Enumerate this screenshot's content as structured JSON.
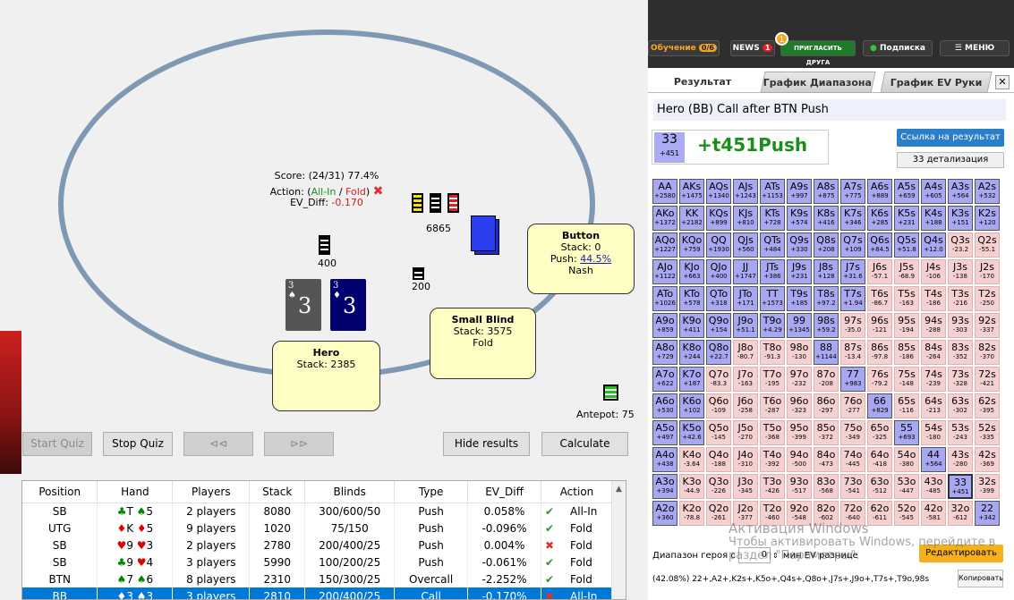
{
  "table_area": {
    "score": "Score: (24/31) 77.4%",
    "action_prefix": "Action: (",
    "action_allin": "All-In",
    "action_sep": " / ",
    "action_fold": "Fold",
    "action_suffix": ")",
    "evdiff_label": "EV_Diff: ",
    "evdiff_value": "-0.170",
    "pot_chips": "6865",
    "hero_chips": "400",
    "sb_chips": "200",
    "antepot": "Antepot: 75",
    "hero_cards": [
      {
        "rank": "3",
        "suit": "♠"
      },
      {
        "rank": "3",
        "suit": "♦"
      }
    ],
    "seats": {
      "hero": {
        "name": "Hero",
        "stack": "Stack: 2385"
      },
      "sb": {
        "name": "Small Blind",
        "stack": "Stack: 3575",
        "action": "Fold"
      },
      "button": {
        "name": "Button",
        "stack": "Stack: 0",
        "push_label": "Push: ",
        "push_value": "44.5%",
        "note": "Nash"
      }
    }
  },
  "controls": {
    "start_quiz": "Start Quiz",
    "stop_quiz": "Stop Quiz",
    "prev": "⊲⊲",
    "next": "⊳⊳",
    "hide_results": "Hide results",
    "calculate": "Calculate"
  },
  "history": {
    "headers": [
      "Position",
      "Hand",
      "Players",
      "Stack",
      "Blinds",
      "Type",
      "EV_Diff",
      "Action"
    ],
    "rows": [
      {
        "pos": "SB",
        "c1": {
          "rank": "T",
          "suit": "club"
        },
        "c2": {
          "rank": "5",
          "suit": "spade"
        },
        "players": "2 players",
        "stack": "8080",
        "blinds": "300/600/50",
        "type": "Push",
        "ev": "0.058%",
        "ok": true,
        "action": "All-In"
      },
      {
        "pos": "UTG",
        "c1": {
          "rank": "K",
          "suit": "diam"
        },
        "c2": {
          "rank": "5",
          "suit": "diam"
        },
        "players": "9 players",
        "stack": "1020",
        "blinds": "75/150",
        "type": "Push",
        "ev": "-0.096%",
        "ok": true,
        "action": "Fold"
      },
      {
        "pos": "SB",
        "c1": {
          "rank": "9",
          "suit": "heart"
        },
        "c2": {
          "rank": "3",
          "suit": "heart"
        },
        "players": "2 players",
        "stack": "2780",
        "blinds": "200/400/25",
        "type": "Push",
        "ev": "0.004%",
        "ok": false,
        "action": "Fold"
      },
      {
        "pos": "SB",
        "c1": {
          "rank": "9",
          "suit": "club"
        },
        "c2": {
          "rank": "4",
          "suit": "heart"
        },
        "players": "3 players",
        "stack": "5990",
        "blinds": "100/200/25",
        "type": "Push",
        "ev": "-0.061%",
        "ok": true,
        "action": "Fold"
      },
      {
        "pos": "BTN",
        "c1": {
          "rank": "7",
          "suit": "spade"
        },
        "c2": {
          "rank": "6",
          "suit": "spade"
        },
        "players": "8 players",
        "stack": "2310",
        "blinds": "150/300/25",
        "type": "Overcall",
        "ev": "-2.252%",
        "ok": true,
        "action": "Fold"
      },
      {
        "pos": "BB",
        "c1": {
          "rank": "3",
          "suit": "diam"
        },
        "c2": {
          "rank": "3",
          "suit": "spade"
        },
        "players": "3 players",
        "stack": "2810",
        "blinds": "200/400/25",
        "type": "Call",
        "ev": "-0.170%",
        "ok": false,
        "action": "All-In",
        "selected": true
      }
    ]
  },
  "topbar": {
    "training": "Обучение",
    "training_badge": "0/6",
    "news": "NEWS",
    "news_badge": "1",
    "invite": "ПРИГЛАСИТЬ ДРУГА",
    "invite_badge": "1",
    "subscription": "Подписка",
    "menu": "МЕНЮ"
  },
  "tabs": [
    "Результат",
    "График Диапазона",
    "График EV Руки"
  ],
  "result": {
    "header": "Hero (BB) Call after BTN Push",
    "hand": "33",
    "hand_ev": "+451",
    "ev_text": "+t451Push",
    "link_button": "Ссылка на результат",
    "detail_button": "33 детализация"
  },
  "range_grid": [
    [
      [
        "AA",
        "+2580",
        "c"
      ],
      [
        "AKs",
        "+1475",
        "c"
      ],
      [
        "AQs",
        "+1340",
        "c"
      ],
      [
        "AJs",
        "+1243",
        "c"
      ],
      [
        "ATs",
        "+1153",
        "c"
      ],
      [
        "A9s",
        "+997",
        "c"
      ],
      [
        "A8s",
        "+875",
        "c"
      ],
      [
        "A7s",
        "+775",
        "c"
      ],
      [
        "A6s",
        "+889",
        "c"
      ],
      [
        "A5s",
        "+659",
        "c"
      ],
      [
        "A4s",
        "+605",
        "c"
      ],
      [
        "A3s",
        "+564",
        "c"
      ],
      [
        "A2s",
        "+532",
        "c"
      ]
    ],
    [
      [
        "AKo",
        "+1372",
        "c"
      ],
      [
        "KK",
        "+2182",
        "c"
      ],
      [
        "KQs",
        "+899",
        "c"
      ],
      [
        "KJs",
        "+810",
        "c"
      ],
      [
        "KTs",
        "+728",
        "c"
      ],
      [
        "K9s",
        "+574",
        "c"
      ],
      [
        "K8s",
        "+416",
        "c"
      ],
      [
        "K7s",
        "+346",
        "c"
      ],
      [
        "K6s",
        "+285",
        "c"
      ],
      [
        "K5s",
        "+231",
        "c"
      ],
      [
        "K4s",
        "+188",
        "c"
      ],
      [
        "K3s",
        "+151",
        "c"
      ],
      [
        "K2s",
        "+120",
        "c"
      ]
    ],
    [
      [
        "AQo",
        "+1227",
        "c"
      ],
      [
        "KQo",
        "+759",
        "c"
      ],
      [
        "QQ",
        "+1930",
        "c"
      ],
      [
        "QJs",
        "+560",
        "c"
      ],
      [
        "QTs",
        "+484",
        "c"
      ],
      [
        "Q9s",
        "+330",
        "c"
      ],
      [
        "Q8s",
        "+208",
        "c"
      ],
      [
        "Q7s",
        "+109",
        "c"
      ],
      [
        "Q6s",
        "+84.5",
        "c"
      ],
      [
        "Q5s",
        "+51.8",
        "c"
      ],
      [
        "Q4s",
        "+12.0",
        "c"
      ],
      [
        "Q3s",
        "-23.2",
        "f"
      ],
      [
        "Q2s",
        "-55.1",
        "f"
      ]
    ],
    [
      [
        "AJo",
        "+1122",
        "c"
      ],
      [
        "KJo",
        "+663",
        "c"
      ],
      [
        "QJo",
        "+400",
        "c"
      ],
      [
        "JJ",
        "+1747",
        "c"
      ],
      [
        "JTs",
        "+386",
        "c"
      ],
      [
        "J9s",
        "+231",
        "c"
      ],
      [
        "J8s",
        "+128",
        "c"
      ],
      [
        "J7s",
        "+31.6",
        "c"
      ],
      [
        "J6s",
        "-57.1",
        "f"
      ],
      [
        "J5s",
        "-68.9",
        "f"
      ],
      [
        "J4s",
        "-106",
        "f"
      ],
      [
        "J3s",
        "-138",
        "f"
      ],
      [
        "J2s",
        "-170",
        "f"
      ]
    ],
    [
      [
        "ATo",
        "+1026",
        "c"
      ],
      [
        "KTo",
        "+578",
        "c"
      ],
      [
        "QTo",
        "+318",
        "c"
      ],
      [
        "JTo",
        "+171",
        "c"
      ],
      [
        "TT",
        "+1573",
        "c"
      ],
      [
        "T9s",
        "+185",
        "c"
      ],
      [
        "T8s",
        "+97.2",
        "c"
      ],
      [
        "T7s",
        "+1.94",
        "c"
      ],
      [
        "T6s",
        "-86.7",
        "f"
      ],
      [
        "T5s",
        "-163",
        "f"
      ],
      [
        "T4s",
        "-186",
        "f"
      ],
      [
        "T3s",
        "-216",
        "f"
      ],
      [
        "T2s",
        "-250",
        "f"
      ]
    ],
    [
      [
        "A9o",
        "+859",
        "c"
      ],
      [
        "K9o",
        "+411",
        "c"
      ],
      [
        "Q9o",
        "+154",
        "c"
      ],
      [
        "J9o",
        "+51.1",
        "c"
      ],
      [
        "T9o",
        "+4.29",
        "c"
      ],
      [
        "99",
        "+1345",
        "c"
      ],
      [
        "98s",
        "+59.2",
        "c"
      ],
      [
        "97s",
        "-35.0",
        "f"
      ],
      [
        "96s",
        "-121",
        "f"
      ],
      [
        "95s",
        "-194",
        "f"
      ],
      [
        "94s",
        "-288",
        "f"
      ],
      [
        "93s",
        "-303",
        "f"
      ],
      [
        "92s",
        "-337",
        "f"
      ]
    ],
    [
      [
        "A8o",
        "+729",
        "c"
      ],
      [
        "K8o",
        "+244",
        "c"
      ],
      [
        "Q8o",
        "+22.7",
        "c"
      ],
      [
        "J8o",
        "-80.7",
        "f"
      ],
      [
        "T8o",
        "-91.3",
        "f"
      ],
      [
        "98o",
        "-130",
        "f"
      ],
      [
        "88",
        "+1144",
        "c"
      ],
      [
        "87s",
        "-13.4",
        "f"
      ],
      [
        "86s",
        "-97.8",
        "f"
      ],
      [
        "85s",
        "-186",
        "f"
      ],
      [
        "84s",
        "-264",
        "f"
      ],
      [
        "83s",
        "-352",
        "f"
      ],
      [
        "82s",
        "-370",
        "f"
      ]
    ],
    [
      [
        "A7o",
        "+622",
        "c"
      ],
      [
        "K7o",
        "+187",
        "c"
      ],
      [
        "Q7o",
        "-83.3",
        "f"
      ],
      [
        "J7o",
        "-163",
        "f"
      ],
      [
        "T7o",
        "-195",
        "f"
      ],
      [
        "97o",
        "-232",
        "f"
      ],
      [
        "87o",
        "-208",
        "f"
      ],
      [
        "77",
        "+983",
        "c"
      ],
      [
        "76s",
        "-79.2",
        "f"
      ],
      [
        "75s",
        "-148",
        "f"
      ],
      [
        "74s",
        "-239",
        "f"
      ],
      [
        "73s",
        "-328",
        "f"
      ],
      [
        "72s",
        "-421",
        "f"
      ]
    ],
    [
      [
        "A6o",
        "+530",
        "c"
      ],
      [
        "K6o",
        "+102",
        "c"
      ],
      [
        "Q6o",
        "-109",
        "f"
      ],
      [
        "J6o",
        "-258",
        "f"
      ],
      [
        "T6o",
        "-287",
        "f"
      ],
      [
        "96o",
        "-323",
        "f"
      ],
      [
        "86o",
        "-297",
        "f"
      ],
      [
        "76o",
        "-277",
        "f"
      ],
      [
        "66",
        "+829",
        "c"
      ],
      [
        "65s",
        "-116",
        "f"
      ],
      [
        "64s",
        "-213",
        "f"
      ],
      [
        "63s",
        "-302",
        "f"
      ],
      [
        "62s",
        "-395",
        "f"
      ]
    ],
    [
      [
        "A5o",
        "+497",
        "c"
      ],
      [
        "K5o",
        "+42.6",
        "c"
      ],
      [
        "Q5o",
        "-145",
        "f"
      ],
      [
        "J5o",
        "-270",
        "f"
      ],
      [
        "T5o",
        "-368",
        "f"
      ],
      [
        "95o",
        "-399",
        "f"
      ],
      [
        "85o",
        "-372",
        "f"
      ],
      [
        "75o",
        "-349",
        "f"
      ],
      [
        "65o",
        "-325",
        "f"
      ],
      [
        "55",
        "+693",
        "c"
      ],
      [
        "54s",
        "-180",
        "f"
      ],
      [
        "53s",
        "-243",
        "f"
      ],
      [
        "52s",
        "-335",
        "f"
      ]
    ],
    [
      [
        "A4o",
        "+438",
        "c"
      ],
      [
        "K4o",
        "-3.64",
        "f"
      ],
      [
        "Q4o",
        "-188",
        "f"
      ],
      [
        "J4o",
        "-310",
        "f"
      ],
      [
        "T4o",
        "-392",
        "f"
      ],
      [
        "94o",
        "-500",
        "f"
      ],
      [
        "84o",
        "-473",
        "f"
      ],
      [
        "74o",
        "-445",
        "f"
      ],
      [
        "64o",
        "-418",
        "f"
      ],
      [
        "54o",
        "-380",
        "f"
      ],
      [
        "44",
        "+564",
        "c"
      ],
      [
        "43s",
        "-280",
        "f"
      ],
      [
        "42s",
        "-369",
        "f"
      ]
    ],
    [
      [
        "A3o",
        "+394",
        "c"
      ],
      [
        "K3o",
        "-44.9",
        "f"
      ],
      [
        "Q3o",
        "-226",
        "f"
      ],
      [
        "J3o",
        "-345",
        "f"
      ],
      [
        "T3o",
        "-426",
        "f"
      ],
      [
        "93o",
        "-517",
        "f"
      ],
      [
        "83o",
        "-568",
        "f"
      ],
      [
        "73o",
        "-541",
        "f"
      ],
      [
        "63o",
        "-512",
        "f"
      ],
      [
        "53o",
        "-447",
        "f"
      ],
      [
        "43o",
        "-485",
        "f"
      ],
      [
        "33",
        "+451",
        "c"
      ],
      [
        "32s",
        "-399",
        "f"
      ]
    ],
    [
      [
        "A2o",
        "+360",
        "c"
      ],
      [
        "K2o",
        "-78.8",
        "f"
      ],
      [
        "Q2o",
        "-261",
        "f"
      ],
      [
        "J2o",
        "-377",
        "f"
      ],
      [
        "T2o",
        "-460",
        "f"
      ],
      [
        "92o",
        "-548",
        "f"
      ],
      [
        "82o",
        "-602",
        "f"
      ],
      [
        "72o",
        "-640",
        "f"
      ],
      [
        "62o",
        "-611",
        "f"
      ],
      [
        "52o",
        "-545",
        "f"
      ],
      [
        "42o",
        "-581",
        "f"
      ],
      [
        "32o",
        "-612",
        "f"
      ],
      [
        "22",
        "+342",
        "c"
      ]
    ]
  ],
  "range_footer": {
    "label_before": "Диапазон героя с",
    "threshold": "0",
    "label_after": "мин EV разнице",
    "edit_button": "Редактировать",
    "range_text": "(42.08%) 22+,A2+,K2s+,K5o+,Q4s+,Q8o+,J7s+,J9o+,T7s+,T9o,98s",
    "copy_button": "Копировать"
  },
  "os_watermark": {
    "line1": "Активация Windows",
    "line2": "Чтобы активировать Windows, перейдите в",
    "line3": "раздел \"Параметры\"."
  }
}
